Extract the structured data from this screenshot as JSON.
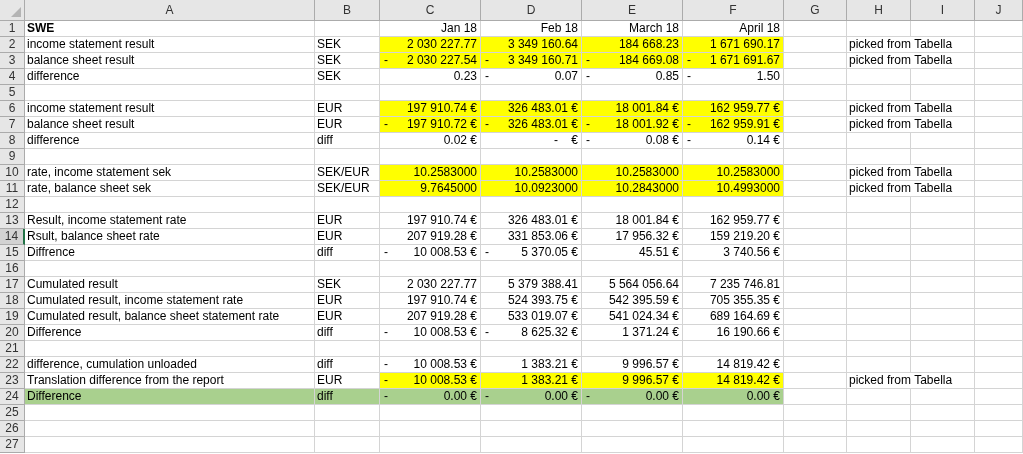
{
  "columns": [
    {
      "label": "A",
      "selected": false
    },
    {
      "label": "B",
      "selected": false
    },
    {
      "label": "C",
      "selected": false
    },
    {
      "label": "D",
      "selected": false
    },
    {
      "label": "E",
      "selected": false
    },
    {
      "label": "F",
      "selected": false
    },
    {
      "label": "G",
      "selected": false
    },
    {
      "label": "H",
      "selected": false
    },
    {
      "label": "I",
      "selected": false
    },
    {
      "label": "J",
      "selected": false
    }
  ],
  "rows": [
    {
      "number": "1",
      "selected": false,
      "kind": "header",
      "label": "SWE",
      "values": [
        {
          "text": "Jan 18"
        },
        {
          "text": "Feb 18"
        },
        {
          "text": "March 18"
        },
        {
          "text": "April 18"
        }
      ]
    },
    {
      "number": "2",
      "selected": false,
      "kind": "data",
      "color": "#ffff00",
      "label": "income statement result",
      "unit": "SEK",
      "values": [
        {
          "text": "2 030 227.77"
        },
        {
          "text": "3 349 160.64"
        },
        {
          "text": "184 668.23"
        },
        {
          "text": "1 671 690.17"
        }
      ],
      "note": "picked from Tabella"
    },
    {
      "number": "3",
      "selected": false,
      "kind": "data",
      "color": "#ffff00",
      "label": "balance sheet result",
      "unit": "SEK",
      "values": [
        {
          "sign": "-",
          "text": "2 030 227.54"
        },
        {
          "sign": "-",
          "text": "3 349 160.71"
        },
        {
          "sign": "-",
          "text": "184 669.08"
        },
        {
          "sign": "-",
          "text": "1 671 691.67"
        }
      ],
      "note": "picked from Tabella"
    },
    {
      "number": "4",
      "selected": false,
      "kind": "data",
      "label": "difference",
      "unit": "SEK",
      "values": [
        {
          "text": "0.23"
        },
        {
          "sign": "-",
          "text": "0.07"
        },
        {
          "sign": "-",
          "text": "0.85"
        },
        {
          "sign": "-",
          "text": "1.50"
        }
      ]
    },
    {
      "number": "5",
      "selected": false,
      "kind": "blank"
    },
    {
      "number": "6",
      "selected": false,
      "kind": "data",
      "color": "#ffff00",
      "label": "income statement result",
      "unit": "EUR",
      "values": [
        {
          "text": "197 910.74 €"
        },
        {
          "text": "326 483.01 €"
        },
        {
          "text": "18 001.84 €"
        },
        {
          "text": "162 959.77 €"
        }
      ],
      "note": "picked from Tabella"
    },
    {
      "number": "7",
      "selected": false,
      "kind": "data",
      "color": "#ffff00",
      "label": "balance sheet result",
      "unit": "EUR",
      "values": [
        {
          "sign": "-",
          "text": "197 910.72 €"
        },
        {
          "sign": "-",
          "text": "326 483.01 €"
        },
        {
          "sign": "-",
          "text": "18 001.92 €"
        },
        {
          "sign": "-",
          "text": "162 959.91 €"
        }
      ],
      "note": "picked from Tabella"
    },
    {
      "number": "8",
      "selected": false,
      "kind": "data",
      "label": "difference",
      "unit": "diff",
      "values": [
        {
          "text": "0.02 €"
        },
        {
          "text": "-    €"
        },
        {
          "sign": "-",
          "text": "0.08 €"
        },
        {
          "sign": "-",
          "text": "0.14 €"
        }
      ]
    },
    {
      "number": "9",
      "selected": false,
      "kind": "blank"
    },
    {
      "number": "10",
      "selected": false,
      "kind": "data",
      "color": "#ffff00",
      "label": "rate, income statement sek",
      "unit": "SEK/EUR",
      "values": [
        {
          "text": "10.2583000"
        },
        {
          "text": "10.2583000"
        },
        {
          "text": "10.2583000"
        },
        {
          "text": "10.2583000"
        }
      ],
      "note": "picked from Tabella"
    },
    {
      "number": "11",
      "selected": false,
      "kind": "data",
      "color": "#ffff00",
      "label": "rate, balance sheet sek",
      "unit": "SEK/EUR",
      "values": [
        {
          "text": "9.7645000"
        },
        {
          "text": "10.0923000"
        },
        {
          "text": "10.2843000"
        },
        {
          "text": "10.4993000"
        }
      ],
      "note": "picked from Tabella"
    },
    {
      "number": "12",
      "selected": false,
      "kind": "blank"
    },
    {
      "number": "13",
      "selected": false,
      "kind": "data",
      "label": "Result, income statement rate",
      "unit": "EUR",
      "values": [
        {
          "text": "197 910.74 €"
        },
        {
          "text": "326 483.01 €"
        },
        {
          "text": "18 001.84 €"
        },
        {
          "text": "162 959.77 €"
        }
      ]
    },
    {
      "number": "14",
      "selected": true,
      "kind": "data",
      "label": "Rsult, balance sheet rate",
      "unit": "EUR",
      "values": [
        {
          "text": "207 919.28 €"
        },
        {
          "text": "331 853.06 €"
        },
        {
          "text": "17 956.32 €"
        },
        {
          "text": "159 219.20 €"
        }
      ]
    },
    {
      "number": "15",
      "selected": false,
      "kind": "data",
      "label": "Diffrence",
      "unit": "diff",
      "values": [
        {
          "sign": "-",
          "text": "10 008.53 €"
        },
        {
          "sign": "-",
          "text": "5 370.05 €"
        },
        {
          "text": "45.51 €"
        },
        {
          "text": "3 740.56 €"
        }
      ]
    },
    {
      "number": "16",
      "selected": false,
      "kind": "blank"
    },
    {
      "number": "17",
      "selected": false,
      "kind": "data",
      "label": "Cumulated result",
      "unit": "SEK",
      "values": [
        {
          "text": "2 030 227.77"
        },
        {
          "text": "5 379 388.41"
        },
        {
          "text": "5 564 056.64"
        },
        {
          "text": "7 235 746.81"
        }
      ]
    },
    {
      "number": "18",
      "selected": false,
      "kind": "data",
      "label": "Cumulated result, income statement rate",
      "unit": "EUR",
      "values": [
        {
          "text": "197 910.74 €"
        },
        {
          "text": "524 393.75 €"
        },
        {
          "text": "542 395.59 €"
        },
        {
          "text": "705 355.35 €"
        }
      ]
    },
    {
      "number": "19",
      "selected": false,
      "kind": "data",
      "label": "Cumulated result, balance sheet statement rate",
      "unit": "EUR",
      "values": [
        {
          "text": "207 919.28 €"
        },
        {
          "text": "533 019.07 €"
        },
        {
          "text": "541 024.34 €"
        },
        {
          "text": "689 164.69 €"
        }
      ]
    },
    {
      "number": "20",
      "selected": false,
      "kind": "data",
      "label": "Difference",
      "unit": "diff",
      "values": [
        {
          "sign": "-",
          "text": "10 008.53 €"
        },
        {
          "sign": "-",
          "text": "8 625.32 €"
        },
        {
          "text": "1 371.24 €"
        },
        {
          "text": "16 190.66 €"
        }
      ]
    },
    {
      "number": "21",
      "selected": false,
      "kind": "blank"
    },
    {
      "number": "22",
      "selected": false,
      "kind": "data",
      "label": "difference, cumulation unloaded",
      "unit": "diff",
      "values": [
        {
          "sign": "-",
          "text": "10 008.53 €"
        },
        {
          "text": "1 383.21 €"
        },
        {
          "text": "9 996.57 €"
        },
        {
          "text": "14 819.42 €"
        }
      ]
    },
    {
      "number": "23",
      "selected": false,
      "kind": "data",
      "color": "#ffff00",
      "label": "Translation difference from the report",
      "unit": "EUR",
      "values": [
        {
          "sign": "-",
          "text": "10 008.53 €"
        },
        {
          "text": "1 383.21 €"
        },
        {
          "text": "9 996.57 €"
        },
        {
          "text": "14 819.42 €"
        }
      ],
      "note": "picked from Tabella"
    },
    {
      "number": "24",
      "selected": false,
      "kind": "total",
      "color": "#a9d08e",
      "label": "Difference",
      "unit": "diff",
      "values": [
        {
          "sign": "-",
          "text": "0.00 €"
        },
        {
          "sign": "-",
          "text": "0.00 €"
        },
        {
          "sign": "-",
          "text": "0.00 €"
        },
        {
          "text": "0.00 €"
        }
      ]
    },
    {
      "number": "25",
      "selected": false,
      "kind": "blank"
    },
    {
      "number": "26",
      "selected": false,
      "kind": "blank"
    },
    {
      "number": "27",
      "selected": false,
      "kind": "blank"
    }
  ]
}
